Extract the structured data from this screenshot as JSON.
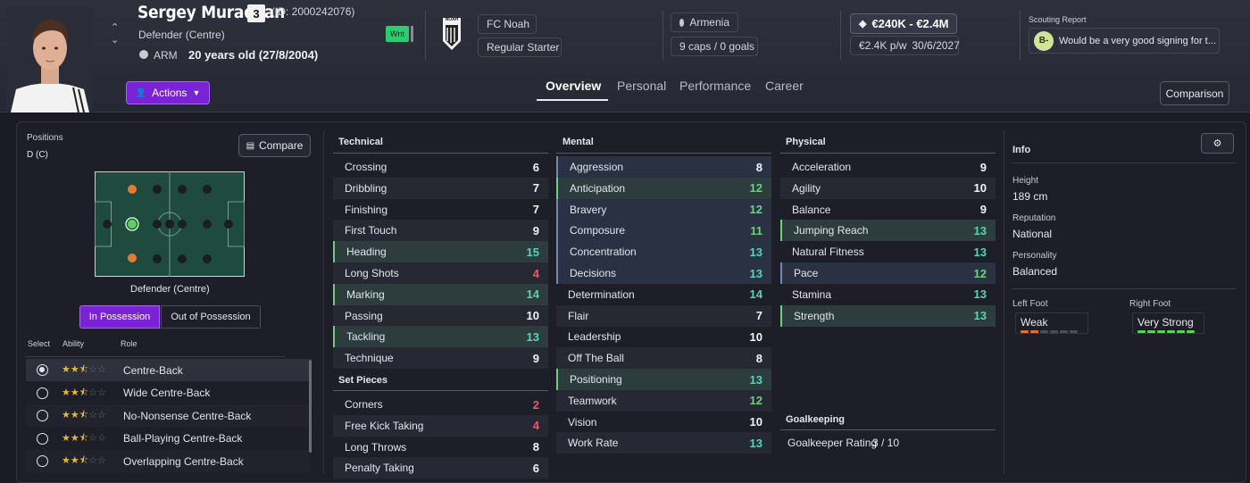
{
  "player": {
    "name": "Sergey Muradyan",
    "number": "3",
    "id": "(ID: 2000242076)",
    "position": "Defender (Centre)",
    "nation_code": "ARM",
    "age": "20 years old (27/8/2004)",
    "status_badge": "Wnt"
  },
  "club": {
    "name": "FC Noah",
    "role": "Regular Starter",
    "logo_text": "NOAH"
  },
  "nation": {
    "name": "Armenia",
    "caps": "9 caps / 0 goals"
  },
  "value": {
    "range": "€240K - €2.4M",
    "wage": "€2.4K p/w",
    "contract": "30/6/2027"
  },
  "scouting": {
    "title": "Scouting Report",
    "grade": "B-",
    "text": "Would be a very good signing for t..."
  },
  "actions_label": "Actions",
  "tabs": [
    "Overview",
    "Personal",
    "Performance",
    "Career"
  ],
  "comparison_label": "Comparison",
  "positions": {
    "title": "Positions",
    "code": "D (C)",
    "compare_label": "Compare",
    "pitch_label": "Defender (Centre)",
    "toggle": [
      "In Possession",
      "Out of Possession"
    ],
    "columns": [
      "Select",
      "Ability",
      "Role"
    ],
    "roles": [
      {
        "name": "Centre-Back",
        "stars": 2.5,
        "selected": true
      },
      {
        "name": "Wide Centre-Back",
        "stars": 2.5,
        "selected": false
      },
      {
        "name": "No-Nonsense Centre-Back",
        "stars": 2.5,
        "selected": false
      },
      {
        "name": "Ball-Playing Centre-Back",
        "stars": 2.5,
        "selected": false
      },
      {
        "name": "Overlapping Centre-Back",
        "stars": 2.5,
        "selected": false
      }
    ]
  },
  "technical": {
    "title": "Technical",
    "attrs": [
      {
        "name": "Crossing",
        "value": "6"
      },
      {
        "name": "Dribbling",
        "value": "7"
      },
      {
        "name": "Finishing",
        "value": "7"
      },
      {
        "name": "First Touch",
        "value": "9"
      },
      {
        "name": "Heading",
        "value": "15"
      },
      {
        "name": "Long Shots",
        "value": "4"
      },
      {
        "name": "Marking",
        "value": "14"
      },
      {
        "name": "Passing",
        "value": "10"
      },
      {
        "name": "Tackling",
        "value": "13"
      },
      {
        "name": "Technique",
        "value": "9"
      }
    ]
  },
  "set_pieces": {
    "title": "Set Pieces",
    "attrs": [
      {
        "name": "Corners",
        "value": "2"
      },
      {
        "name": "Free Kick Taking",
        "value": "4"
      },
      {
        "name": "Long Throws",
        "value": "8"
      },
      {
        "name": "Penalty Taking",
        "value": "6"
      }
    ]
  },
  "mental": {
    "title": "Mental",
    "attrs": [
      {
        "name": "Aggression",
        "value": "8"
      },
      {
        "name": "Anticipation",
        "value": "12"
      },
      {
        "name": "Bravery",
        "value": "12"
      },
      {
        "name": "Composure",
        "value": "11"
      },
      {
        "name": "Concentration",
        "value": "13"
      },
      {
        "name": "Decisions",
        "value": "13"
      },
      {
        "name": "Determination",
        "value": "14"
      },
      {
        "name": "Flair",
        "value": "7"
      },
      {
        "name": "Leadership",
        "value": "10"
      },
      {
        "name": "Off The Ball",
        "value": "8"
      },
      {
        "name": "Positioning",
        "value": "13"
      },
      {
        "name": "Teamwork",
        "value": "12"
      },
      {
        "name": "Vision",
        "value": "10"
      },
      {
        "name": "Work Rate",
        "value": "13"
      }
    ]
  },
  "physical": {
    "title": "Physical",
    "attrs": [
      {
        "name": "Acceleration",
        "value": "9"
      },
      {
        "name": "Agility",
        "value": "10"
      },
      {
        "name": "Balance",
        "value": "9"
      },
      {
        "name": "Jumping Reach",
        "value": "13"
      },
      {
        "name": "Natural Fitness",
        "value": "13"
      },
      {
        "name": "Pace",
        "value": "12"
      },
      {
        "name": "Stamina",
        "value": "13"
      },
      {
        "name": "Strength",
        "value": "13"
      }
    ]
  },
  "goalkeeping": {
    "title": "Goalkeeping",
    "label": "Goalkeeper Rating",
    "value": "3 / 10"
  },
  "info": {
    "title": "Info",
    "height_label": "Height",
    "height": "189 cm",
    "reputation_label": "Reputation",
    "reputation": "National",
    "personality_label": "Personality",
    "personality": "Balanced",
    "left_foot_label": "Left Foot",
    "left_foot": "Weak",
    "left_foot_level": 2,
    "right_foot_label": "Right Foot",
    "right_foot": "Very Strong",
    "right_foot_level": 6
  },
  "colors": {
    "accent": "#7a22d6",
    "good": "#6fcf7f",
    "great": "#52d6b8",
    "bad": "#f0566a",
    "star": "#e6b93c",
    "pitch": "#1f4a3e",
    "orange_dot": "#e27a34"
  }
}
